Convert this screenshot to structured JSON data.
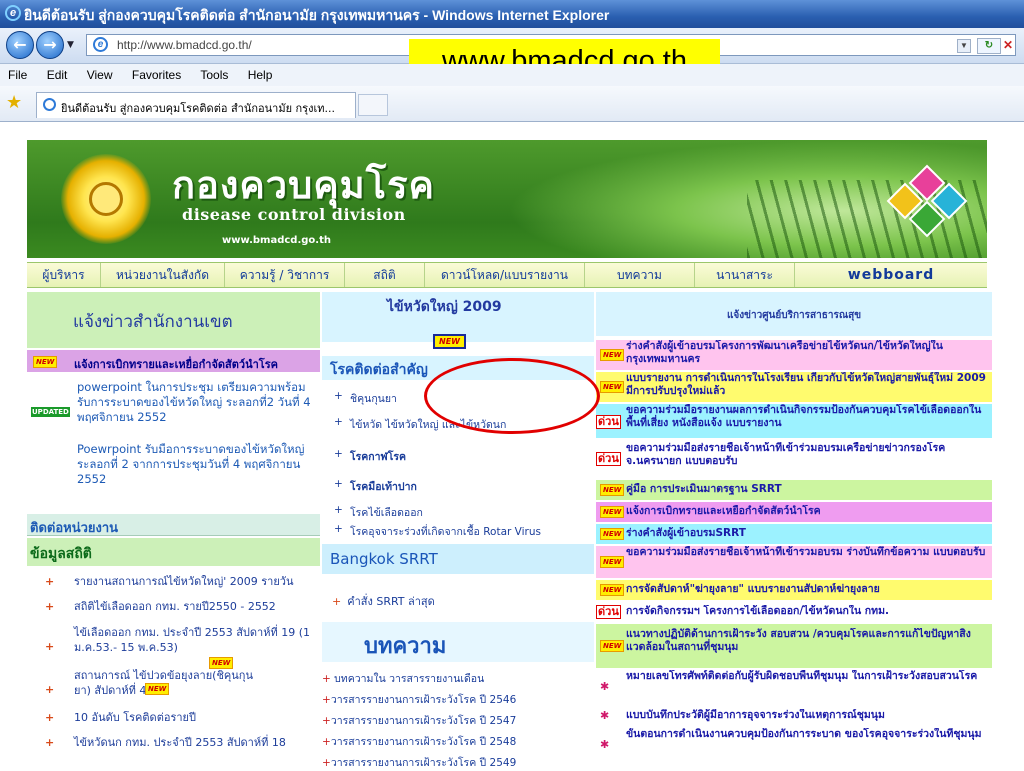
{
  "window": {
    "title": "ยินดีต้อนรับ สู่กองควบคุมโรคติดต่อ สำนักอนามัย กรุงเทพมหานคร - Windows Internet Explorer",
    "url": "http://www.bmadcd.go.th/",
    "menu": [
      "File",
      "Edit",
      "View",
      "Favorites",
      "Tools",
      "Help"
    ],
    "tab_title": "ยินดีต้อนรับ สู่กองควบคุมโรคติดต่อ สำนักอนามัย กรุงเท...",
    "icons": {
      "back": "back-arrow-icon",
      "forward": "forward-arrow-icon",
      "favorites": "star-icon",
      "refresh": "refresh-icon",
      "stop": "stop-icon",
      "browser": "ie-logo-icon"
    }
  },
  "callout": "www.bmadcd.go.th",
  "banner": {
    "title_th": "กองควบคุมโรค",
    "title_en": "disease control division",
    "url": "www.bmadcd.go.th"
  },
  "nav": [
    "ผู้บริหาร",
    "หน่วยงานในสังกัด",
    "ความรู้ / วิชาการ",
    "สถิติ",
    "ดาวน์โหลด/แบบรายงาน",
    "บทความ",
    "นานาสาระ",
    "webboard"
  ],
  "highlighted_nav": "ดาวน์โหลด/แบบรายงาน",
  "left": {
    "news_heading": "แจ้งข่าวสำนักงานเขต",
    "new_badge": "NEW",
    "updated_badge": "UPDATED",
    "top_item": "แจ้งการเบิกทรายและเหยื่อกำจัดสัตว์นำโรค",
    "items": [
      "powerpoint ในการประชุม เตรียมความพร้อมรับการระบาดของไข้หวัดใหญ่ ระลอกที่2 วันที่ 4 พฤศจิกายน 2552",
      "Poewrpoint รับมือการระบาดของไข้หวัดใหญ่ ระลอกที่ 2 จากการประชุมวันที่ 4 พฤศจิกายน 2552"
    ],
    "contact_heading": "ติดต่อหน่วยงาน",
    "stats_heading": "ข้อมูลสถิติ",
    "stats": [
      "รายงานสถานการณ์ไข้หวัดใหญ่' 2009 รายวัน",
      "สถิติไข้เลือดออก กทม. รายปี2550 - 2552",
      "ไข้เลือดออก กทม. ประจำปี 2553 สัปดาห์ที่ 19 (1 ม.ค.53.- 15 พ.ค.53)",
      "สถานการณ์ ไข้ปวดข้อยุงลาย(ชิคุนกุนยา) สัปดาห์ที่ 42",
      "10 อันดับ โรคติดต่อรายปี",
      "ไข้หวัดนก กทม. ประจำปี 2553 สัปดาห์ที่ 18"
    ]
  },
  "middle": {
    "flu_heading": "ไข้หวัดใหญ่ 2009",
    "diseases_heading": "โรคติดต่อสำคัญ",
    "diseases": [
      "ชิคุนกุนยา",
      "ไข้หวัด ไข้หวัดใหญ่ และไข้หวัดนก",
      "โรคกาฬโรค",
      "โรคมือเท้าปาก",
      "โรคไข้เลือดออก",
      "โรคอุจจาระร่วงที่เกิดจากเชื้อ Rotar Virus"
    ],
    "srrt_heading": "Bangkok SRRT",
    "srrt_item": "คำสั่ง SRRT ล่าสุด",
    "articles_heading": "บทความ",
    "articles": [
      "บทความใน วารสารรายงานเดือน",
      "วารสารรายงานการเฝ้าระวังโรค ปี 2546",
      "วารสารรายงานการเฝ้าระวังโรค ปี 2547",
      "วารสารรายงานการเฝ้าระวังโรค ปี 2548",
      "วารสารรายงานการเฝ้าระวังโรค ปี 2549"
    ]
  },
  "right": {
    "heading": "แจ้งข่าวศูนย์บริการสาธารณสุข",
    "urgent": "ด่วน",
    "items": [
      "ร่างคำสั่งผู้เข้าอบรมโครงการพัฒนาเครือข่ายไข้หวัดนก/ไข้หวัดใหญ่ในกรุงเทพมหานคร",
      "แบบรายงาน การดำเนินการในโรงเรียน เกี่ยวกับไข้หวัดใหญ่สายพันธุ์ใหม่ 2009 มีการปรับปรุงใหม่แล้ว",
      "ขอความร่วมมือรายงานผลการดำเนินกิจกรรมป้องกันควบคุมโรคไข้เลือดออกในพื้นที่เสี่ยง หนังสือแจ้ง แบบรายงาน",
      "ขอความร่วมมือส่งรายชื่อเจ้าหน้าที่เข้าร่วมอบรมเครือข่ายข่าวกรองโรค จ.นครนายก แบบตอบรับ",
      "คู่มือ การประเมินมาตรฐาน SRRT",
      "แจ้งการเบิกทรายและเหยื่อกำจัดสัตว์นำโรค",
      "ร่างคำสั่งผู้เข้าอบรมSRRT",
      "ขอความร่วมมือส่งรายชื่อเจ้าหน้าที่เข้ารวมอบรม ร่างบันทึกข้อความ แบบตอบรับ",
      "การจัดสัปดาห์\"ฆ่ายุงลาย\" แบบรายงานสัปดาห์ฆ่ายุงลาย",
      "การจัดกิจกรรมฯ โครงการไข้เลือดออก/ไข้หวัดนกใน กทม.",
      "แนวทางปฏิบัติด้านการเฝ้าระวัง สอบสวน /ควบคุมโรคและการแก้ไขปัญหาสิ่งแวดล้อมในสถานที่ชุมนุม",
      "หมายเลขโทรศัพท์ติดต่อกับผู้รับผิดชอบพื้นที่ชุมนุม ในการเฝ้าระวังสอบสวนโรค",
      "แบบบันทึกประวัติผู้มีอาการอุจจาระร่วงในเหตุการณ์ชุมนุม",
      "ขั้นตอนการดำเนินงานควบคุมป้องกันการระบาด ของโรคอุจจาระร่วงในที่ชุมนุม"
    ]
  },
  "colors": {
    "annotation_circle": "#e10000",
    "callout_bg": "#ffff00",
    "banner_green": "#2f7a1c"
  }
}
